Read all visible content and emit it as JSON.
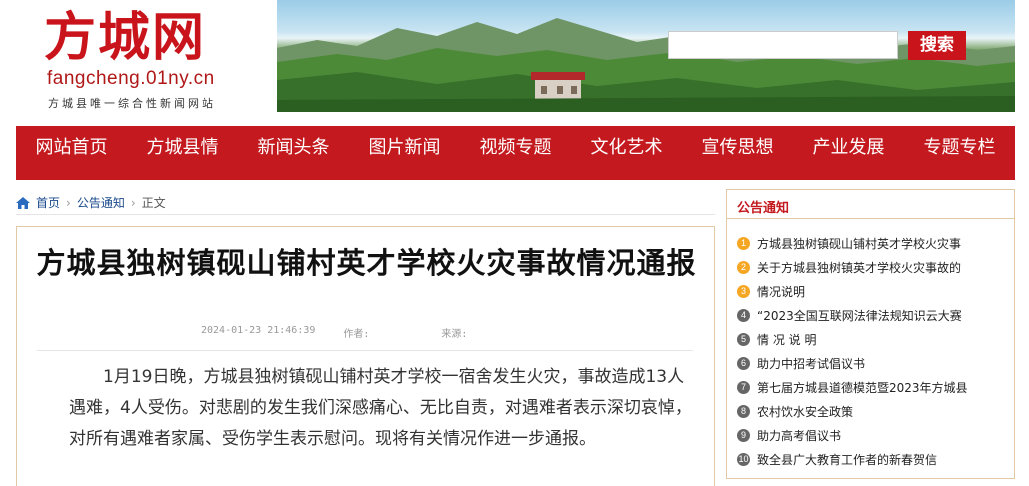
{
  "header": {
    "logo_cn": "方城网",
    "logo_url": "fangcheng.01ny.cn",
    "slogan": "方城县唯一综合性新闻网站",
    "search": {
      "placeholder": "",
      "button_label": "搜索"
    }
  },
  "nav": [
    "网站首页",
    "方城县情",
    "新闻头条",
    "图片新闻",
    "视频专题",
    "文化艺术",
    "宣传思想",
    "产业发展",
    "专题专栏"
  ],
  "breadcrumb": {
    "home": "首页",
    "category": "公告通知",
    "current": "正文"
  },
  "article": {
    "title": "方城县独树镇砚山铺村英才学校火灾事故情况通报",
    "date": "2024-01-23 21:46:39",
    "author_label": "作者:",
    "source_label": "来源:",
    "body": "1月19日晚，方城县独树镇砚山铺村英才学校一宿舍发生火灾，事故造成13人遇难，4人受伤。对悲剧的发生我们深感痛心、无比自责，对遇难者表示深切哀悼，对所有遇难者家属、受伤学生表示慰问。现将有关情况作进一步通报。"
  },
  "sidebar": {
    "title": "公告通知",
    "items": [
      {
        "num": "1",
        "text": "方城县独树镇砚山铺村英才学校火灾事"
      },
      {
        "num": "2",
        "text": "关于方城县独树镇英才学校火灾事故的"
      },
      {
        "num": "3",
        "text": "情况说明"
      },
      {
        "num": "4",
        "text": "“2023全国互联网法律法规知识云大赛"
      },
      {
        "num": "5",
        "text": "情 况 说 明"
      },
      {
        "num": "6",
        "text": "助力中招考试倡议书"
      },
      {
        "num": "7",
        "text": "第七届方城县道德模范暨2023年方城县"
      },
      {
        "num": "8",
        "text": "农村饮水安全政策"
      },
      {
        "num": "9",
        "text": "助力高考倡议书"
      },
      {
        "num": "10",
        "text": "致全县广大教育工作者的新春贺信"
      }
    ]
  },
  "colors": {
    "brand_red": "#c41a1f",
    "hot_badge": "#f5a623",
    "cold_badge": "#666666",
    "border": "#e2c9a6"
  }
}
